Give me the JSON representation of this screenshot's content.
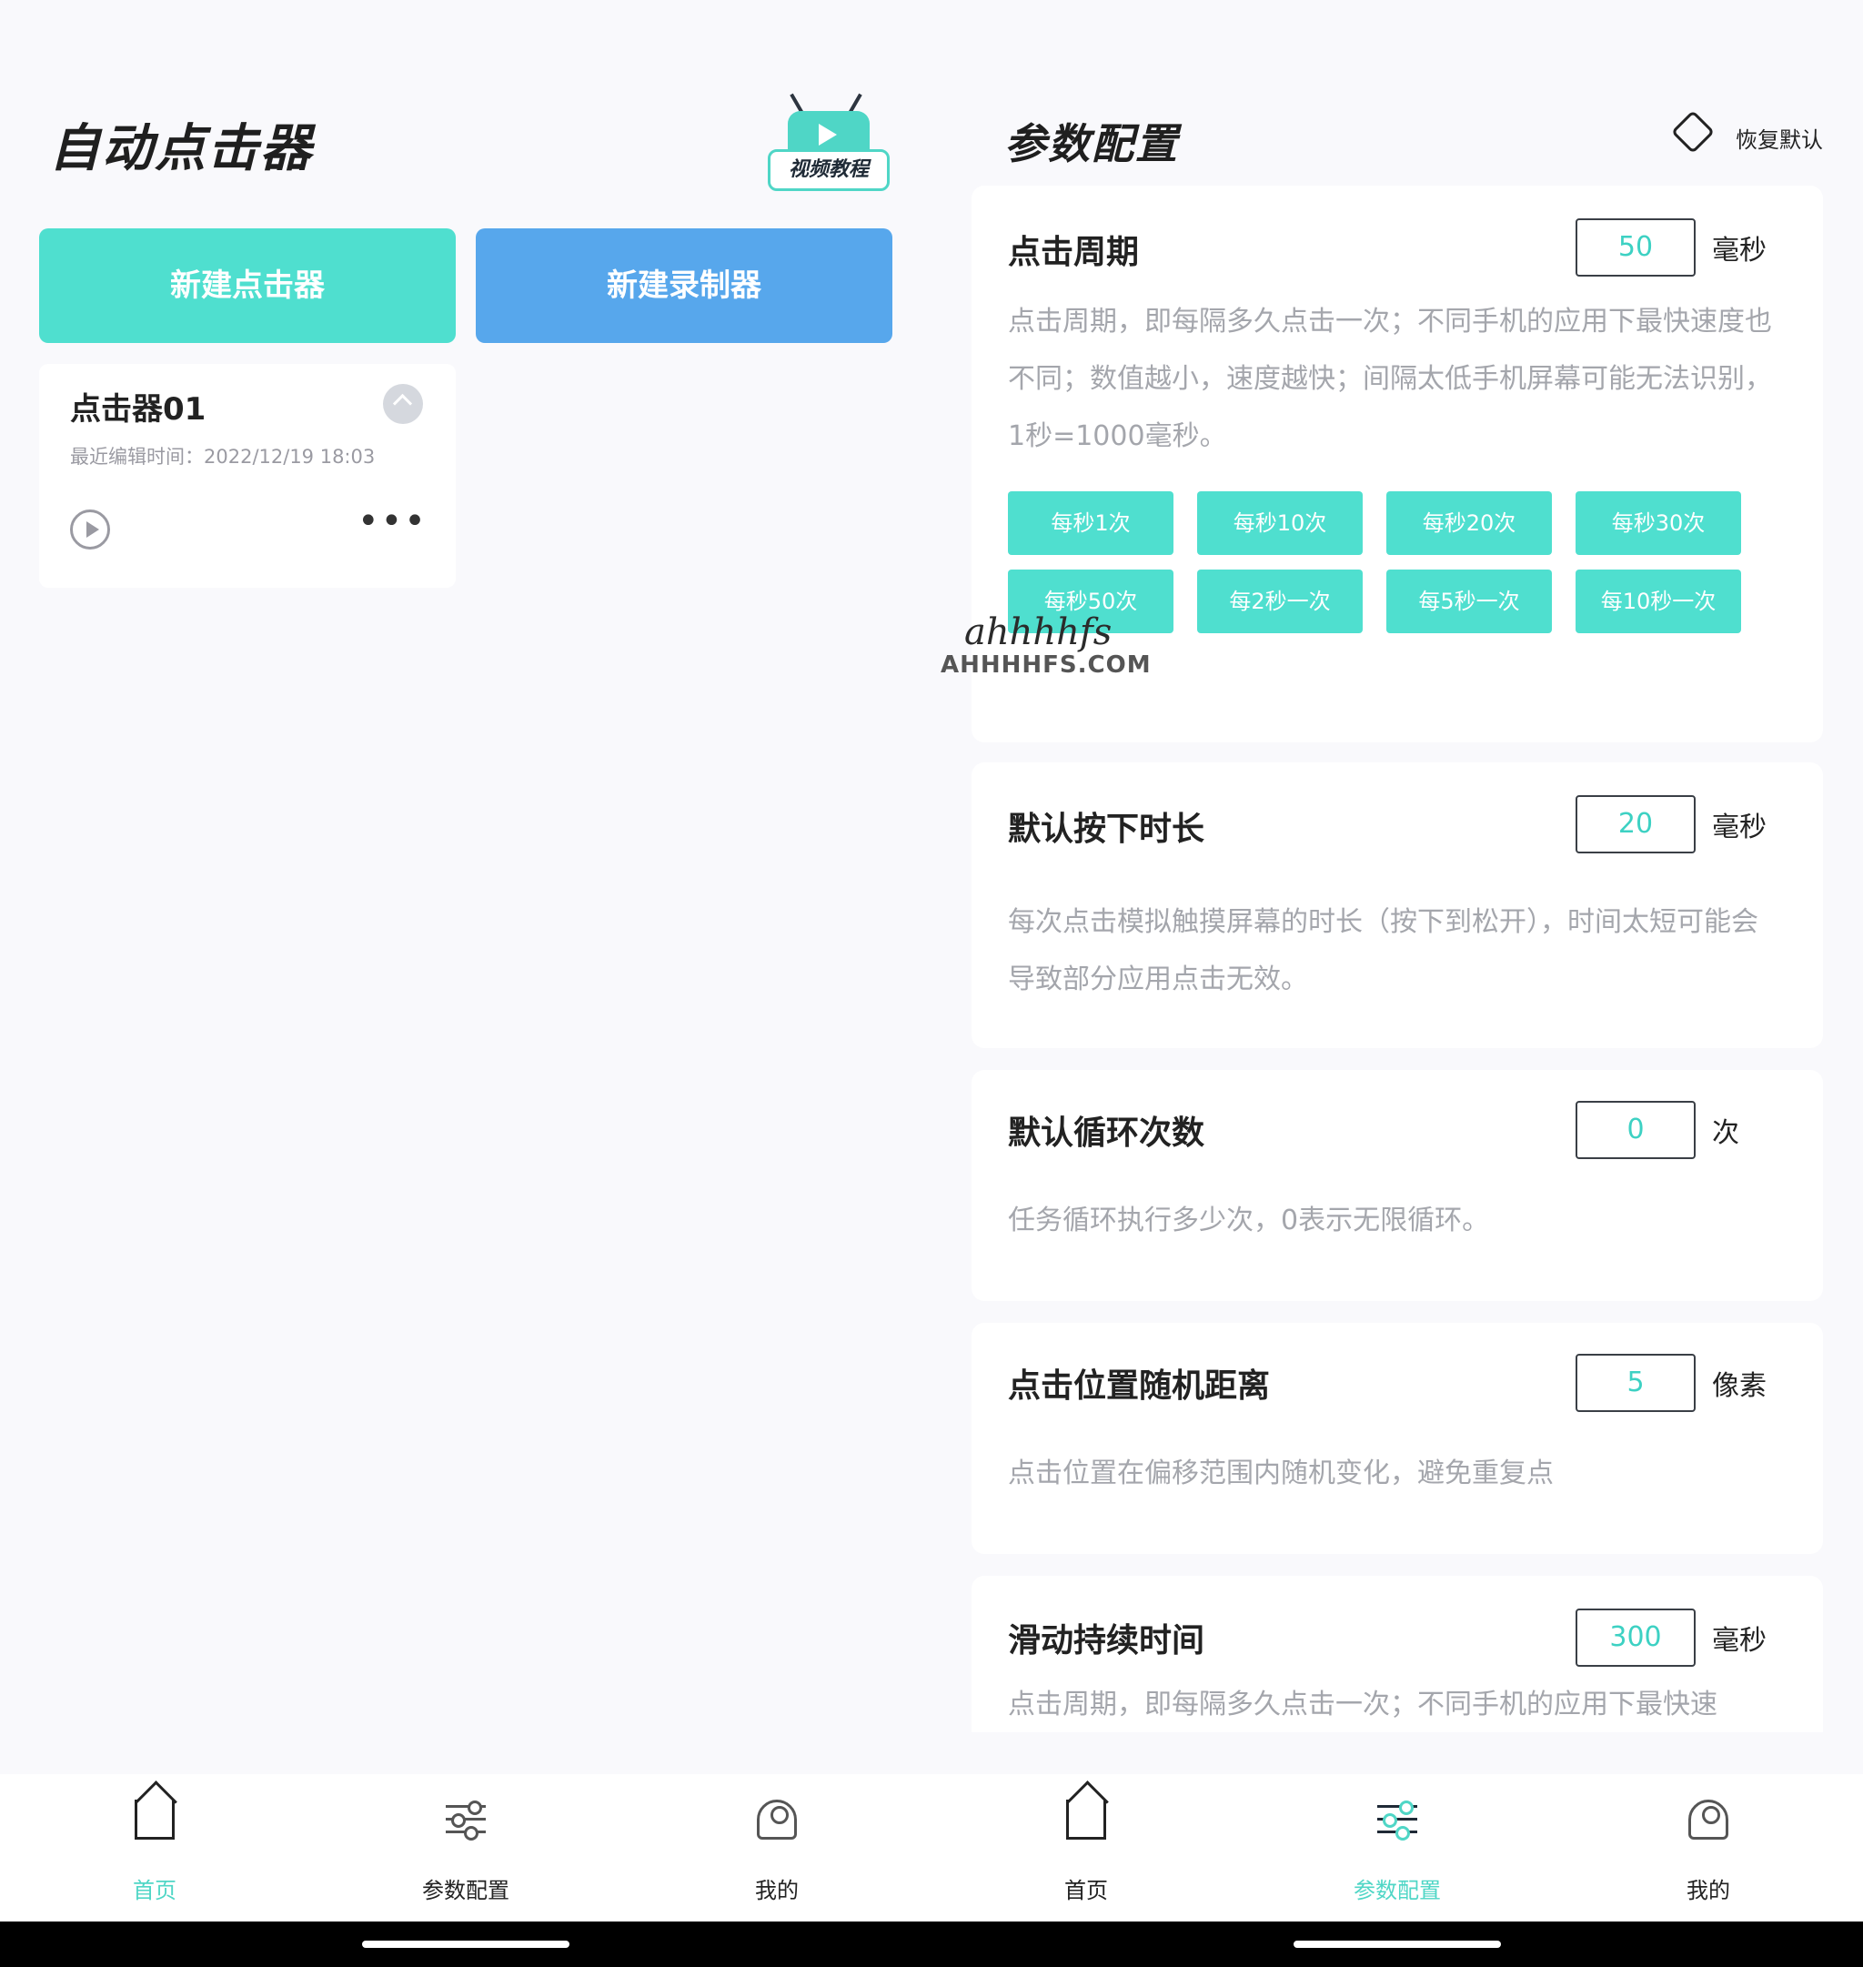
{
  "left": {
    "title": "自动点击器",
    "video_badge_label": "视频教程",
    "new_clicker": "新建点击器",
    "new_recorder": "新建录制器",
    "card": {
      "name": "点击器01",
      "time": "最近编辑时间：2022/12/19 18:03",
      "more": "•••"
    },
    "nav": [
      {
        "label": "首页",
        "icon": "home-icon"
      },
      {
        "label": "参数配置",
        "icon": "settings-icon"
      },
      {
        "label": "我的",
        "icon": "user-icon"
      }
    ]
  },
  "right": {
    "title": "参数配置",
    "restore_label": "恢复默认",
    "watermark": {
      "brand": "ahhhhfs",
      "domain": "AHHHHFS.COM"
    },
    "sections": [
      {
        "title": "点击周期",
        "value": "50",
        "unit": "毫秒",
        "desc": "点击周期，即每隔多久点击一次；不同手机的应用下最快速度也不同；数值越小，速度越快；间隔太低手机屏幕可能无法识别，1秒=1000毫秒。",
        "presets": [
          "每秒1次",
          "每秒10次",
          "每秒20次",
          "每秒30次",
          "每秒50次",
          "每2秒一次",
          "每5秒一次",
          "每10秒一次"
        ]
      },
      {
        "title": "默认按下时长",
        "value": "20",
        "unit": "毫秒",
        "desc": "每次点击模拟触摸屏幕的时长（按下到松开），时间太短可能会导致部分应用点击无效。"
      },
      {
        "title": "默认循环次数",
        "value": "0",
        "unit": "次",
        "desc": "任务循环执行多少次，0表示无限循环。"
      },
      {
        "title": "点击位置随机距离",
        "value": "5",
        "unit": "像素",
        "desc": "点击位置在偏移范围内随机变化，避免重复点"
      },
      {
        "title": "滑动持续时间",
        "value": "300",
        "unit": "毫秒",
        "desc": "点击周期，即每隔多久点击一次；不同手机的应用下最快速"
      }
    ],
    "nav": [
      {
        "label": "首页",
        "icon": "home-icon"
      },
      {
        "label": "参数配置",
        "icon": "settings-icon"
      },
      {
        "label": "我的",
        "icon": "user-icon"
      }
    ]
  },
  "colors": {
    "accent_teal": "#4fdfcf",
    "accent_blue": "#57a7ec",
    "value_text": "#3dd1c3",
    "desc_text": "#a4a6ac"
  }
}
